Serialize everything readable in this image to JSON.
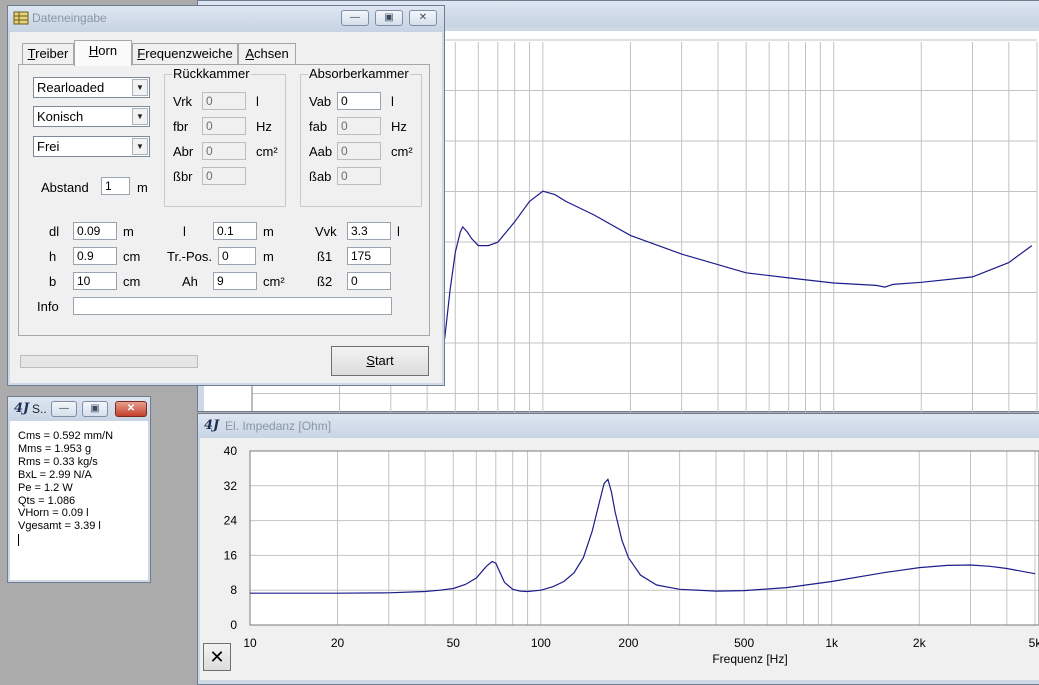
{
  "main_window": {
    "y_axis_ticks": [
      "40",
      "32",
      "24",
      "16",
      "8",
      "0"
    ],
    "x_axis_ticks": [
      "10",
      "20",
      "50",
      "100",
      "200",
      "500",
      "1k",
      "2k",
      "5k"
    ]
  },
  "impedance_window": {
    "title": "El. Impedanz [Ohm]",
    "app_icon": "4J",
    "xlabel": "Frequenz [Hz]",
    "close_icon": "close-x-icon"
  },
  "small_window": {
    "title": "S..",
    "app_icon": "4J",
    "lines": [
      "Cms = 0.592 mm/N",
      "Mms = 1.953 g",
      "Rms = 0.33 kg/s",
      "BxL = 2.99 N/A",
      "Pe = 1.2 W",
      "Qts = 1.086",
      "VHorn = 0.09 l",
      "Vgesamt = 3.39 l"
    ]
  },
  "dialog": {
    "title": "Dateneingabe",
    "tabs": [
      {
        "label": "Treiber",
        "mnemonic": "T",
        "rest": "reiber"
      },
      {
        "label": "Horn",
        "mnemonic": "H",
        "rest": "orn"
      },
      {
        "label": "Frequenzweiche",
        "mnemonic": "F",
        "rest": "requenzweiche"
      },
      {
        "label": "Achsen",
        "mnemonic": "A",
        "rest": "chsen"
      }
    ],
    "combos": [
      "Rearloaded",
      "Konisch",
      "Frei"
    ],
    "abstand": {
      "label": "Abstand",
      "value": "1",
      "unit": "m"
    },
    "rueckkammer": {
      "title": "Rückkammer",
      "rows": [
        {
          "label": "Vrk",
          "value": "0",
          "unit": "l"
        },
        {
          "label": "fbr",
          "value": "0",
          "unit": "Hz"
        },
        {
          "label": "Abr",
          "value": "0",
          "unit": "cm²"
        },
        {
          "label": "ßbr",
          "value": "0",
          "unit": ""
        }
      ]
    },
    "absorberkammer": {
      "title": "Absorberkammer",
      "rows": [
        {
          "label": "Vab",
          "value": "0",
          "unit": "l"
        },
        {
          "label": "fab",
          "value": "0",
          "unit": "Hz"
        },
        {
          "label": "Aab",
          "value": "0",
          "unit": "cm²"
        },
        {
          "label": "ßab",
          "value": "0",
          "unit": ""
        }
      ]
    },
    "params": {
      "dl": {
        "label": "dl",
        "value": "0.09",
        "unit": "m"
      },
      "h": {
        "label": "h",
        "value": "0.9",
        "unit": "cm"
      },
      "b": {
        "label": "b",
        "value": "10",
        "unit": "cm"
      },
      "l": {
        "label": "l",
        "value": "0.1",
        "unit": "m"
      },
      "trpos": {
        "label": "Tr.-Pos.",
        "value": "0",
        "unit": "m"
      },
      "ah": {
        "label": "Ah",
        "value": "9",
        "unit": "cm²"
      },
      "vvk": {
        "label": "Vvk",
        "value": "3.3",
        "unit": "l"
      },
      "b1": {
        "label": "ß1",
        "value": "175"
      },
      "b2": {
        "label": "ß2",
        "value": "0"
      }
    },
    "info": {
      "label": "Info",
      "value": ""
    },
    "progress": 0,
    "start_button": {
      "mnemonic": "S",
      "rest": "tart"
    }
  },
  "chart_data": [
    {
      "type": "line",
      "title": "El. Impedanz [Ohm]",
      "xlabel": "Frequenz [Hz]",
      "ylabel": "",
      "xscale": "log",
      "xlim": [
        10,
        5000
      ],
      "ylim": [
        0,
        40
      ],
      "grid": true,
      "color": "#1c1c8c",
      "series": [
        {
          "x": [
            10,
            20,
            30,
            40,
            45,
            50,
            55,
            60,
            65,
            68,
            70,
            72,
            75,
            80,
            85,
            90,
            100,
            110,
            120,
            130,
            140,
            150,
            160,
            165,
            170,
            175,
            180,
            190,
            200,
            220,
            250,
            300,
            400,
            500,
            700,
            1000,
            1500,
            2000,
            2500,
            3000,
            3500,
            4000,
            5000
          ],
          "y": [
            7.3,
            7.3,
            7.4,
            7.7,
            8.0,
            8.4,
            9.3,
            10.8,
            13.5,
            14.6,
            14.2,
            12.4,
            9.8,
            8.2,
            7.8,
            7.7,
            8.0,
            8.8,
            10.0,
            12.0,
            15.5,
            21.5,
            29.0,
            32.5,
            33.5,
            30.5,
            26.0,
            19.5,
            15.5,
            11.5,
            9.2,
            8.2,
            7.8,
            7.9,
            8.6,
            10.0,
            12.0,
            13.2,
            13.7,
            13.8,
            13.5,
            13.0,
            11.8
          ]
        }
      ]
    },
    {
      "type": "line",
      "xscale": "log",
      "grid": true,
      "color": "#1c1c8c",
      "series": [
        {
          "x": [
            44,
            46,
            48,
            50,
            52,
            53,
            55,
            57,
            60,
            65,
            70,
            80,
            90,
            100,
            110,
            120,
            150,
            200,
            300,
            500,
            700,
            1000,
            1400,
            1500,
            1600,
            2000,
            3000,
            4000,
            4800
          ],
          "y": [
            -21,
            -11,
            3,
            14,
            20,
            21.5,
            20,
            18,
            16,
            16,
            17,
            23,
            29,
            32,
            31,
            29,
            25,
            19,
            13.5,
            8,
            6.5,
            5,
            4.3,
            3.8,
            4.6,
            5.2,
            6.8,
            11,
            16
          ]
        }
      ]
    }
  ]
}
